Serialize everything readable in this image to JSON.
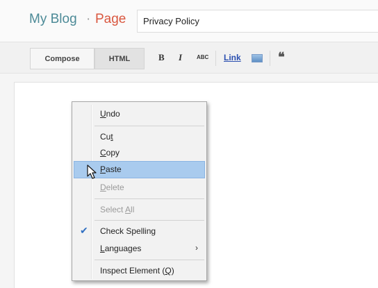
{
  "header": {
    "blog_name": "My Blog",
    "separator": "·",
    "page_label": "Page",
    "title_value": "Privacy Policy"
  },
  "toolbar": {
    "compose_label": "Compose",
    "html_label": "HTML",
    "bold_label": "B",
    "italic_label": "I",
    "spell_label": "ABC",
    "link_label": "Link",
    "image_icon": "image-icon",
    "quote_label": "❝"
  },
  "context_menu": {
    "items": [
      {
        "label_pre": "",
        "label_u": "U",
        "label_post": "ndo",
        "disabled": false
      },
      {
        "label_pre": "Cu",
        "label_u": "t",
        "label_post": "",
        "disabled": false
      },
      {
        "label_pre": "",
        "label_u": "C",
        "label_post": "opy",
        "disabled": false
      },
      {
        "label_pre": "",
        "label_u": "P",
        "label_post": "aste",
        "disabled": false,
        "highlighted": true
      },
      {
        "label_pre": "",
        "label_u": "D",
        "label_post": "elete",
        "disabled": true
      },
      {
        "label_pre": "Select ",
        "label_u": "A",
        "label_post": "ll",
        "disabled": true
      },
      {
        "label_pre": "Check Spelling",
        "label_u": "",
        "label_post": "",
        "checked": true
      },
      {
        "label_pre": "",
        "label_u": "L",
        "label_post": "anguages",
        "submenu": true
      },
      {
        "label_pre": "Inspect Element (",
        "label_u": "Q",
        "label_post": ")",
        "disabled": false
      }
    ],
    "check_glyph": "✔",
    "arrow_glyph": "›"
  },
  "colors": {
    "blog_name": "#4c8a97",
    "page_label": "#d9573f",
    "link": "#2a4fb0",
    "highlight": "#a9cbee"
  }
}
